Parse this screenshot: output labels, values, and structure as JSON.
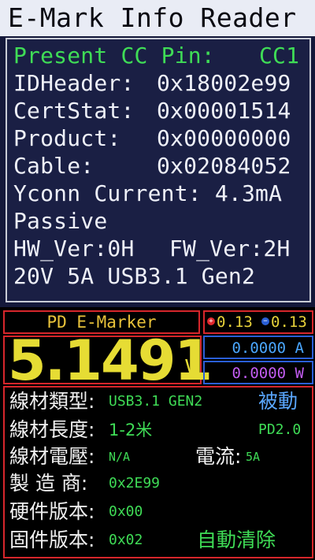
{
  "header": {
    "title": "E-Mark Info Reader"
  },
  "info": {
    "cc_pin_label": "Present CC Pin:",
    "cc_pin_value": "CC1",
    "idheader_label": "IDHeader:",
    "idheader_value": "0x18002e99",
    "certstat_label": "CertStat:",
    "certstat_value": "0x00001514",
    "product_label": "Product:",
    "product_value": "0x00000000",
    "cable_label": "Cable:",
    "cable_value": "0x02084052",
    "vconn": "Yconn Current: 4.3mA",
    "type": "Passive",
    "hw_ver": "HW_Ver:0H",
    "fw_ver": "FW_Ver:2H",
    "spec": "20V 5A USB3.1 Gen2"
  },
  "meter": {
    "mode_label": "PD E-Marker",
    "cc1": "0.13",
    "cc2": "0.13",
    "cc1_color": "#e0282d",
    "cc2_color": "#2a5fd6",
    "voltage": "5.1491",
    "voltage_unit": "V",
    "current": "0.0000 A",
    "power": "0.0000 W",
    "current_color": "#4aa6ff",
    "power_color": "#c25cf2"
  },
  "details": {
    "cable_type_label": "線材類型:",
    "cable_type_value": "USB3.1 GEN2",
    "passive_label": "被動",
    "length_label": "線材長度:",
    "length_value": "1-2米",
    "pd_version": "PD2.0",
    "voltage_label": "線材電壓:",
    "voltage_value": "N/A",
    "current_label": "電流:",
    "current_value": "5A",
    "vendor_label": "製 造 商:",
    "vendor_value": "0x2E99",
    "hw_label": "硬件版本:",
    "hw_value": "0x00",
    "fw_label": "固件版本:",
    "fw_value": "0x02",
    "auto_clear": "自動清除"
  }
}
